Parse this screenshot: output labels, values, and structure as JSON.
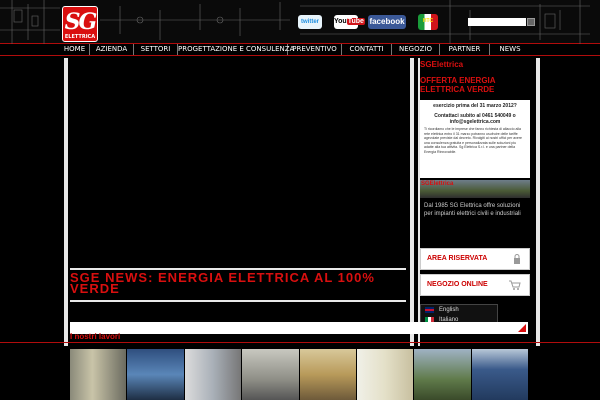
{
  "brand": {
    "logo_text": "SG",
    "logo_sub": "ELETTRICA"
  },
  "social": {
    "twitter": "twitter",
    "youtube_you": "You",
    "youtube_tube": "Tube",
    "facebook": "facebook",
    "flag": "HTC"
  },
  "search": {
    "placeholder": ""
  },
  "nav": [
    "HOME",
    "AZIENDA",
    "SETTORI",
    "PROGETTAZIONE E CONSULENZA",
    "PREVENTIVO",
    "CONTATTI",
    "NEGOZIO",
    "PARTNER",
    "NEWS"
  ],
  "main": {
    "news_heading": "SGE NEWS: ENERGIA ELETTRICA AL 100% VERDE"
  },
  "sidebar": {
    "title": "SGElettrica",
    "headline": "OFFERTA ENERGIA ELETTRICA VERDE",
    "notice_title": "esercizio prima del 31 marzo 2012?",
    "notice_contact": "Contattaci subito al 0461 540049 o info@sgelettrica.com",
    "notice_body": "Ti ricordiamo che le imprese che fanno richiesta di allaccio alla rete elettrica entro il 31 marzo potranno usufruire delle tariffe agevolate previste dal decreto. Rivolgiti ai nostri uffici per avere una consulenza gratuita e personalizzata sulle soluzioni piu adatte alla tua attivita. Sg Elettrica S.r.l. e una partner della Energia Rinnovabile.",
    "photo_label": "SGElettrica",
    "text": "Dal 1985 SG Elettrica offre soluzioni per impianti elettrici civili e industriali",
    "area_riservata": "AREA RISERVATA",
    "negozio_online": "NEGOZIO ONLINE",
    "languages": [
      "English",
      "Italiano"
    ]
  },
  "gallery": {
    "title": "I nostri lavori"
  },
  "colors": {
    "brand_red": "#d90f0f",
    "background": "#000000",
    "panel_border": "#e8e8e8"
  }
}
